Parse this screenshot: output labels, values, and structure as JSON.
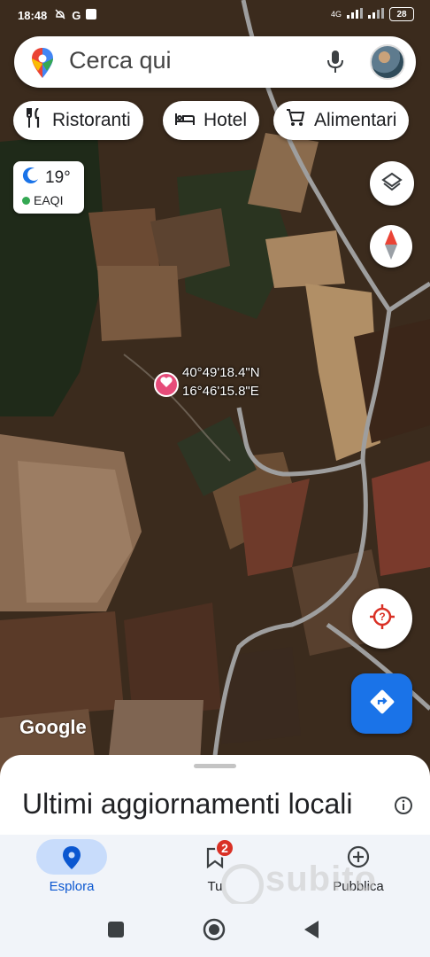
{
  "status_bar": {
    "time": "18:48",
    "left_icons": [
      "do-not-disturb-icon",
      "google-icon",
      "app-icon"
    ],
    "network": "4G",
    "battery": "28"
  },
  "search": {
    "placeholder": "Cerca qui",
    "icons": [
      "google-maps-pin-icon",
      "microphone-icon",
      "avatar"
    ]
  },
  "chips": [
    {
      "label": "Ristoranti",
      "icon": "fork-knife-icon"
    },
    {
      "label": "Hotel",
      "icon": "bed-icon"
    },
    {
      "label": "Alimentari",
      "icon": "cart-icon"
    }
  ],
  "weather": {
    "temp": "19°",
    "aqi_label": "EAQI",
    "icon": "moon-icon",
    "aqi_color": "#34a853"
  },
  "map": {
    "coords_lat": "40°49'18.4\"N",
    "coords_lon": "16°46'15.8\"E",
    "attribution": "Google",
    "pin_color": "#e64b79"
  },
  "sheet": {
    "title": "Ultimi aggiornamenti locali"
  },
  "bottom_nav": {
    "items": [
      {
        "label": "Esplora",
        "icon": "location-pin-icon",
        "active": true
      },
      {
        "label": "Tu",
        "icon": "bookmark-icon",
        "badge": "2"
      },
      {
        "label": "Pubblica",
        "icon": "add-circle-icon"
      }
    ]
  },
  "watermark": "subito",
  "colors": {
    "accent_blue": "#1a73e8",
    "directions_button": "#1a73e8",
    "active_pill": "#c8dcfb",
    "badge_red": "#d93025"
  }
}
